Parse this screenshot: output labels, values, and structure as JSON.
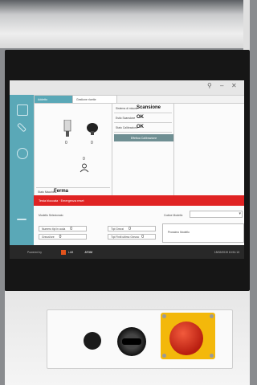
{
  "screen": {
    "tabs": [
      "Home",
      "Scansione",
      "Calibrazione"
    ],
    "header_tabs": [
      "Addetto",
      "Gestione ricette"
    ],
    "left_pane": {
      "tool_a_count": "0",
      "tool_b_count": "0",
      "operator_count": "0",
      "stato_label": "Stato Macchina",
      "stato_value": "Ferma"
    },
    "mid_pane": {
      "rows": [
        {
          "label": "Sistema di misura",
          "value": "Scansione"
        },
        {
          "label": "Esito Scansione",
          "value": "OK"
        },
        {
          "label": "Stato Calibrazione",
          "value": "OK"
        }
      ],
      "calib_button": "Effettua Calibrazione"
    },
    "alarm_text": "Testa bloccata · Emergenza reset",
    "bottom": {
      "model_label": "Modello Selezionato",
      "codice_label": "Codice Modello",
      "counters": [
        {
          "label": "Numero tipi in coda",
          "value": "0"
        },
        {
          "label": "Tipi Grezzi",
          "value": "0"
        },
        {
          "label": "Grezzi/ore",
          "value": "0"
        },
        {
          "label": "Tipi Finiti ultimo Grezzo",
          "value": "0"
        }
      ],
      "next_label": "Prossimo Modello"
    },
    "footer": {
      "powered": "Powered by",
      "brand_a": "LAB",
      "brand_b": "ATOM",
      "datetime": "15/02/2019 10:51:13"
    }
  },
  "colors": {
    "accent": "#5aa8b7",
    "alarm": "#e02323",
    "estop": "#c8261a",
    "estop_base": "#f3b80b",
    "bezel": "#161616"
  }
}
